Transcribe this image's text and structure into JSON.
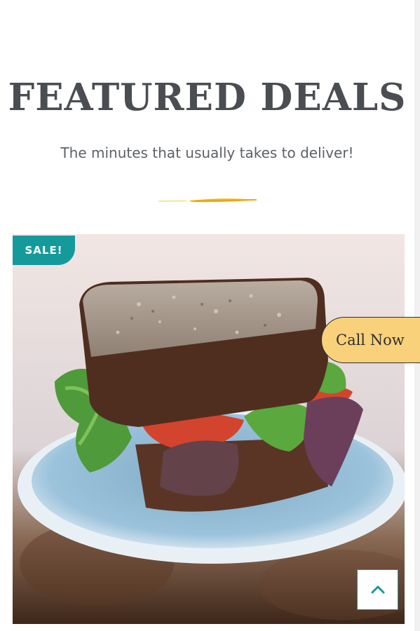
{
  "section": {
    "title": "FEATURED DEALS",
    "subtitle": "The minutes that usually takes to deliver!"
  },
  "product": {
    "badge": "SALE!",
    "image": "sandwich-photo"
  },
  "floating": {
    "call_label": "Call Now",
    "scroll_top_icon": "chevron-up-icon"
  },
  "colors": {
    "accent": "#159a9c",
    "call_button": "#f8d17a",
    "divider": "#f2b80f",
    "title": "#4a4d52"
  }
}
